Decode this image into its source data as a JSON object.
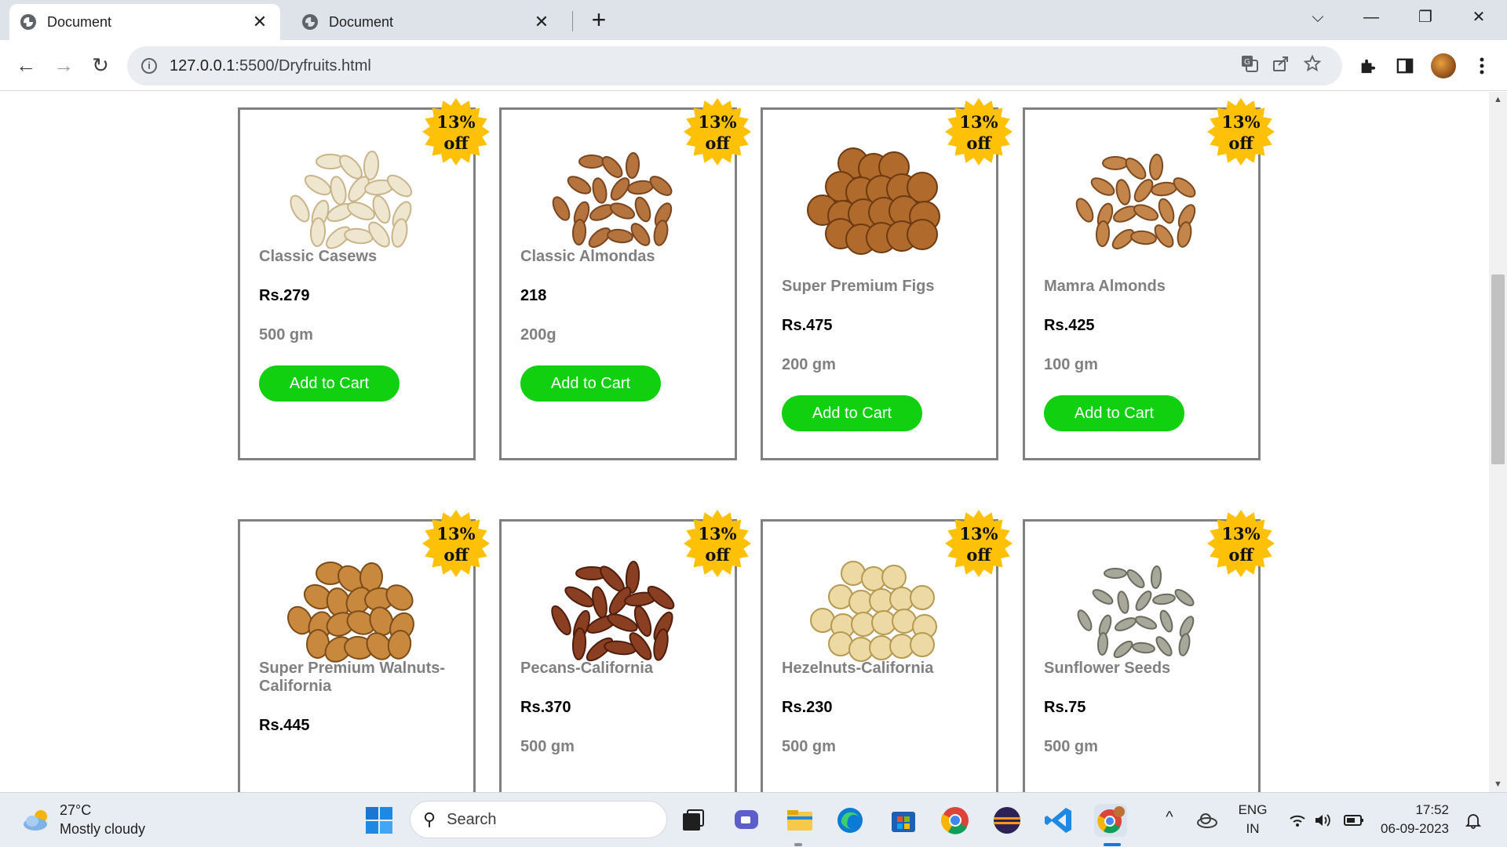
{
  "browser": {
    "tabs": [
      {
        "title": "Document",
        "close": "✕"
      },
      {
        "title": "Document",
        "close": "✕"
      }
    ],
    "new_tab": "+",
    "window_controls": {
      "dropdown": "⌵",
      "minimize": "—",
      "restore": "❐",
      "close": "✕"
    },
    "nav": {
      "back": "←",
      "forward": "→",
      "reload": "↻"
    },
    "url_host": "127.0.0.1",
    "url_path": ":5500/Dryfruits.html",
    "info_icon": "i"
  },
  "products": [
    {
      "name": "Classic Casews",
      "price": "Rs.279",
      "weight": "500 gm",
      "discount_line1": "13%",
      "discount_line2": "off",
      "button": "Add to Cart",
      "image": "cashew"
    },
    {
      "name": "Classic Almondas",
      "price": "218",
      "weight": "200g",
      "discount_line1": "13%",
      "discount_line2": "off",
      "button": "Add to Cart",
      "image": "almond"
    },
    {
      "name": "Super Premium Figs",
      "price": "Rs.475",
      "weight": "200 gm",
      "discount_line1": "13%",
      "discount_line2": "off",
      "button": "Add to Cart",
      "image": "fig"
    },
    {
      "name": "Mamra Almonds",
      "price": "Rs.425",
      "weight": "100 gm",
      "discount_line1": "13%",
      "discount_line2": "off",
      "button": "Add to Cart",
      "image": "mamra-almond"
    },
    {
      "name": "Super Premium Walnuts-California",
      "price": "Rs.445",
      "weight": "",
      "discount_line1": "13%",
      "discount_line2": "off",
      "button": "",
      "image": "walnut"
    },
    {
      "name": "Pecans-California",
      "price": "Rs.370",
      "weight": "500 gm",
      "discount_line1": "13%",
      "discount_line2": "off",
      "button": "",
      "image": "pecan"
    },
    {
      "name": "Hezelnuts-California",
      "price": "Rs.230",
      "weight": "500 gm",
      "discount_line1": "13%",
      "discount_line2": "off",
      "button": "",
      "image": "hazelnut"
    },
    {
      "name": "Sunflower Seeds",
      "price": "Rs.75",
      "weight": "500 gm",
      "discount_line1": "13%",
      "discount_line2": "off",
      "button": "",
      "image": "sunflower-seed"
    }
  ],
  "colors": {
    "button_green": "#10d010",
    "badge_yellow": "#ffc107",
    "card_border": "#808080"
  },
  "taskbar": {
    "weather_temp": "27°C",
    "weather_desc": "Mostly cloudy",
    "search_label": "Search",
    "lang_line1": "ENG",
    "lang_line2": "IN",
    "time": "17:52",
    "date": "06-09-2023",
    "tray_chevron": "^"
  }
}
